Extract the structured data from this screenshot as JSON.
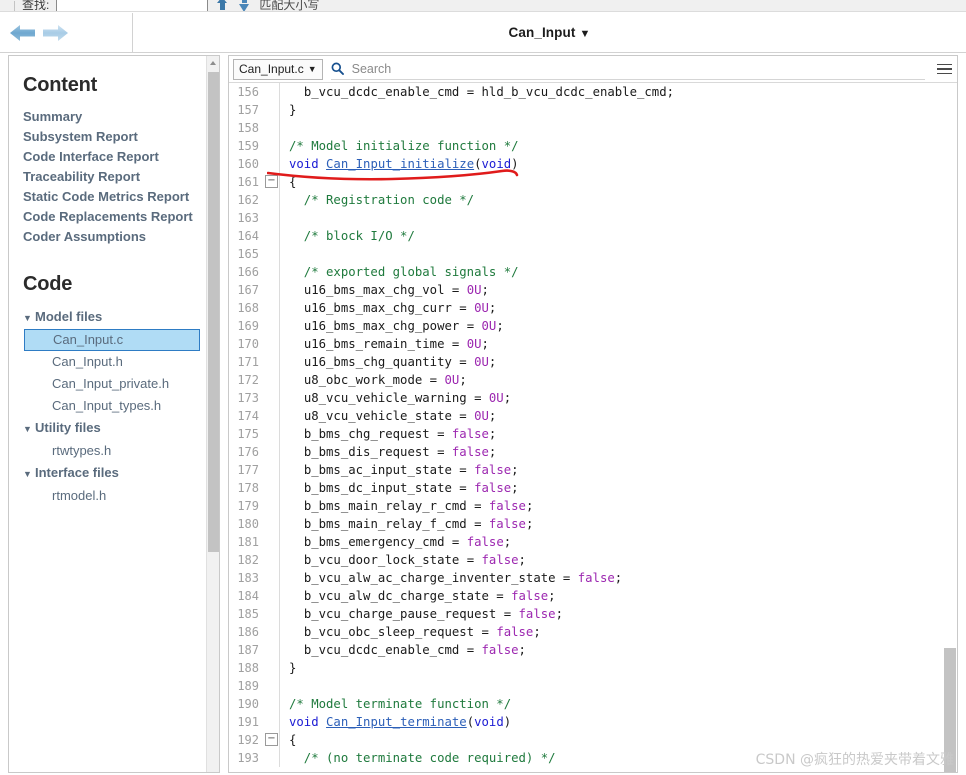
{
  "find_toolbar": {
    "label": "查找:",
    "input_value": "",
    "up_icon": "arrow-up-icon",
    "down_icon": "arrow-down-icon",
    "match_case_label": "匹配大小写"
  },
  "navbar": {
    "back_icon": "back-arrow-icon",
    "forward_icon": "forward-arrow-icon",
    "title": "Can_Input",
    "title_caret": "▼"
  },
  "sidebar": {
    "content_heading": "Content",
    "links": [
      {
        "label": "Summary"
      },
      {
        "label": "Subsystem Report"
      },
      {
        "label": "Code Interface Report"
      },
      {
        "label": "Traceability Report"
      },
      {
        "label": "Static Code Metrics Report"
      },
      {
        "label": "Code Replacements Report"
      },
      {
        "label": "Coder Assumptions"
      }
    ],
    "code_heading": "Code",
    "tree": [
      {
        "group": "Model files",
        "caret": "▼",
        "files": [
          {
            "name": "Can_Input.c",
            "selected": true
          },
          {
            "name": "Can_Input.h",
            "selected": false
          },
          {
            "name": "Can_Input_private.h",
            "selected": false
          },
          {
            "name": "Can_Input_types.h",
            "selected": false
          }
        ]
      },
      {
        "group": "Utility files",
        "caret": "▼",
        "files": [
          {
            "name": "rtwtypes.h",
            "selected": false
          }
        ]
      },
      {
        "group": "Interface files",
        "caret": "▼",
        "files": [
          {
            "name": "rtmodel.h",
            "selected": false
          }
        ]
      }
    ]
  },
  "code_panel": {
    "file_selector": "Can_Input.c",
    "file_selector_caret": "▼",
    "search_icon": "search-icon",
    "search_placeholder": "Search",
    "search_value": "",
    "menu_icon": "hamburger-menu-icon",
    "first_line_number": 156,
    "lines": [
      {
        "n": 156,
        "fold": false,
        "tokens": [
          {
            "t": "  ",
            "c": "tk-punct"
          },
          {
            "t": "b_vcu_dcdc_enable_cmd",
            "c": "tk-id"
          },
          {
            "t": " = ",
            "c": "tk-punct"
          },
          {
            "t": "hld_b_vcu_dcdc_enable_cmd",
            "c": "tk-id"
          },
          {
            "t": ";",
            "c": "tk-punct"
          }
        ]
      },
      {
        "n": 157,
        "fold": false,
        "tokens": [
          {
            "t": "}",
            "c": "tk-punct"
          }
        ]
      },
      {
        "n": 158,
        "fold": false,
        "tokens": []
      },
      {
        "n": 159,
        "fold": false,
        "tokens": [
          {
            "t": "/* Model initialize function */",
            "c": "tk-comment"
          }
        ]
      },
      {
        "n": 160,
        "fold": false,
        "tokens": [
          {
            "t": "void",
            "c": "tk-kw"
          },
          {
            "t": " ",
            "c": "tk-punct"
          },
          {
            "t": "Can_Input_initialize",
            "c": "tk-fn"
          },
          {
            "t": "(",
            "c": "tk-punct"
          },
          {
            "t": "void",
            "c": "tk-kw"
          },
          {
            "t": ")",
            "c": "tk-punct"
          }
        ]
      },
      {
        "n": 161,
        "fold": true,
        "tokens": [
          {
            "t": "{",
            "c": "tk-punct"
          }
        ]
      },
      {
        "n": 162,
        "fold": false,
        "tokens": [
          {
            "t": "  /* Registration code */",
            "c": "tk-comment"
          }
        ]
      },
      {
        "n": 163,
        "fold": false,
        "tokens": []
      },
      {
        "n": 164,
        "fold": false,
        "tokens": [
          {
            "t": "  /* block I/O */",
            "c": "tk-comment"
          }
        ]
      },
      {
        "n": 165,
        "fold": false,
        "tokens": []
      },
      {
        "n": 166,
        "fold": false,
        "tokens": [
          {
            "t": "  /* exported global signals */",
            "c": "tk-comment"
          }
        ]
      },
      {
        "n": 167,
        "fold": false,
        "tokens": [
          {
            "t": "  ",
            "c": "tk-punct"
          },
          {
            "t": "u16_bms_max_chg_vol",
            "c": "tk-id"
          },
          {
            "t": " = ",
            "c": "tk-punct"
          },
          {
            "t": "0U",
            "c": "tk-num"
          },
          {
            "t": ";",
            "c": "tk-punct"
          }
        ]
      },
      {
        "n": 168,
        "fold": false,
        "tokens": [
          {
            "t": "  ",
            "c": "tk-punct"
          },
          {
            "t": "u16_bms_max_chg_curr",
            "c": "tk-id"
          },
          {
            "t": " = ",
            "c": "tk-punct"
          },
          {
            "t": "0U",
            "c": "tk-num"
          },
          {
            "t": ";",
            "c": "tk-punct"
          }
        ]
      },
      {
        "n": 169,
        "fold": false,
        "tokens": [
          {
            "t": "  ",
            "c": "tk-punct"
          },
          {
            "t": "u16_bms_max_chg_power",
            "c": "tk-id"
          },
          {
            "t": " = ",
            "c": "tk-punct"
          },
          {
            "t": "0U",
            "c": "tk-num"
          },
          {
            "t": ";",
            "c": "tk-punct"
          }
        ]
      },
      {
        "n": 170,
        "fold": false,
        "tokens": [
          {
            "t": "  ",
            "c": "tk-punct"
          },
          {
            "t": "u16_bms_remain_time",
            "c": "tk-id"
          },
          {
            "t": " = ",
            "c": "tk-punct"
          },
          {
            "t": "0U",
            "c": "tk-num"
          },
          {
            "t": ";",
            "c": "tk-punct"
          }
        ]
      },
      {
        "n": 171,
        "fold": false,
        "tokens": [
          {
            "t": "  ",
            "c": "tk-punct"
          },
          {
            "t": "u16_bms_chg_quantity",
            "c": "tk-id"
          },
          {
            "t": " = ",
            "c": "tk-punct"
          },
          {
            "t": "0U",
            "c": "tk-num"
          },
          {
            "t": ";",
            "c": "tk-punct"
          }
        ]
      },
      {
        "n": 172,
        "fold": false,
        "tokens": [
          {
            "t": "  ",
            "c": "tk-punct"
          },
          {
            "t": "u8_obc_work_mode",
            "c": "tk-id"
          },
          {
            "t": " = ",
            "c": "tk-punct"
          },
          {
            "t": "0U",
            "c": "tk-num"
          },
          {
            "t": ";",
            "c": "tk-punct"
          }
        ]
      },
      {
        "n": 173,
        "fold": false,
        "tokens": [
          {
            "t": "  ",
            "c": "tk-punct"
          },
          {
            "t": "u8_vcu_vehicle_warning",
            "c": "tk-id"
          },
          {
            "t": " = ",
            "c": "tk-punct"
          },
          {
            "t": "0U",
            "c": "tk-num"
          },
          {
            "t": ";",
            "c": "tk-punct"
          }
        ]
      },
      {
        "n": 174,
        "fold": false,
        "tokens": [
          {
            "t": "  ",
            "c": "tk-punct"
          },
          {
            "t": "u8_vcu_vehicle_state",
            "c": "tk-id"
          },
          {
            "t": " = ",
            "c": "tk-punct"
          },
          {
            "t": "0U",
            "c": "tk-num"
          },
          {
            "t": ";",
            "c": "tk-punct"
          }
        ]
      },
      {
        "n": 175,
        "fold": false,
        "tokens": [
          {
            "t": "  ",
            "c": "tk-punct"
          },
          {
            "t": "b_bms_chg_request",
            "c": "tk-id"
          },
          {
            "t": " = ",
            "c": "tk-punct"
          },
          {
            "t": "false",
            "c": "tk-bool"
          },
          {
            "t": ";",
            "c": "tk-punct"
          }
        ]
      },
      {
        "n": 176,
        "fold": false,
        "tokens": [
          {
            "t": "  ",
            "c": "tk-punct"
          },
          {
            "t": "b_bms_dis_request",
            "c": "tk-id"
          },
          {
            "t": " = ",
            "c": "tk-punct"
          },
          {
            "t": "false",
            "c": "tk-bool"
          },
          {
            "t": ";",
            "c": "tk-punct"
          }
        ]
      },
      {
        "n": 177,
        "fold": false,
        "tokens": [
          {
            "t": "  ",
            "c": "tk-punct"
          },
          {
            "t": "b_bms_ac_input_state",
            "c": "tk-id"
          },
          {
            "t": " = ",
            "c": "tk-punct"
          },
          {
            "t": "false",
            "c": "tk-bool"
          },
          {
            "t": ";",
            "c": "tk-punct"
          }
        ]
      },
      {
        "n": 178,
        "fold": false,
        "tokens": [
          {
            "t": "  ",
            "c": "tk-punct"
          },
          {
            "t": "b_bms_dc_input_state",
            "c": "tk-id"
          },
          {
            "t": " = ",
            "c": "tk-punct"
          },
          {
            "t": "false",
            "c": "tk-bool"
          },
          {
            "t": ";",
            "c": "tk-punct"
          }
        ]
      },
      {
        "n": 179,
        "fold": false,
        "tokens": [
          {
            "t": "  ",
            "c": "tk-punct"
          },
          {
            "t": "b_bms_main_relay_r_cmd",
            "c": "tk-id"
          },
          {
            "t": " = ",
            "c": "tk-punct"
          },
          {
            "t": "false",
            "c": "tk-bool"
          },
          {
            "t": ";",
            "c": "tk-punct"
          }
        ]
      },
      {
        "n": 180,
        "fold": false,
        "tokens": [
          {
            "t": "  ",
            "c": "tk-punct"
          },
          {
            "t": "b_bms_main_relay_f_cmd",
            "c": "tk-id"
          },
          {
            "t": " = ",
            "c": "tk-punct"
          },
          {
            "t": "false",
            "c": "tk-bool"
          },
          {
            "t": ";",
            "c": "tk-punct"
          }
        ]
      },
      {
        "n": 181,
        "fold": false,
        "tokens": [
          {
            "t": "  ",
            "c": "tk-punct"
          },
          {
            "t": "b_bms_emergency_cmd",
            "c": "tk-id"
          },
          {
            "t": " = ",
            "c": "tk-punct"
          },
          {
            "t": "false",
            "c": "tk-bool"
          },
          {
            "t": ";",
            "c": "tk-punct"
          }
        ]
      },
      {
        "n": 182,
        "fold": false,
        "tokens": [
          {
            "t": "  ",
            "c": "tk-punct"
          },
          {
            "t": "b_vcu_door_lock_state",
            "c": "tk-id"
          },
          {
            "t": " = ",
            "c": "tk-punct"
          },
          {
            "t": "false",
            "c": "tk-bool"
          },
          {
            "t": ";",
            "c": "tk-punct"
          }
        ]
      },
      {
        "n": 183,
        "fold": false,
        "tokens": [
          {
            "t": "  ",
            "c": "tk-punct"
          },
          {
            "t": "b_vcu_alw_ac_charge_inventer_state",
            "c": "tk-id"
          },
          {
            "t": " = ",
            "c": "tk-punct"
          },
          {
            "t": "false",
            "c": "tk-bool"
          },
          {
            "t": ";",
            "c": "tk-punct"
          }
        ]
      },
      {
        "n": 184,
        "fold": false,
        "tokens": [
          {
            "t": "  ",
            "c": "tk-punct"
          },
          {
            "t": "b_vcu_alw_dc_charge_state",
            "c": "tk-id"
          },
          {
            "t": " = ",
            "c": "tk-punct"
          },
          {
            "t": "false",
            "c": "tk-bool"
          },
          {
            "t": ";",
            "c": "tk-punct"
          }
        ]
      },
      {
        "n": 185,
        "fold": false,
        "tokens": [
          {
            "t": "  ",
            "c": "tk-punct"
          },
          {
            "t": "b_vcu_charge_pause_request",
            "c": "tk-id"
          },
          {
            "t": " = ",
            "c": "tk-punct"
          },
          {
            "t": "false",
            "c": "tk-bool"
          },
          {
            "t": ";",
            "c": "tk-punct"
          }
        ]
      },
      {
        "n": 186,
        "fold": false,
        "tokens": [
          {
            "t": "  ",
            "c": "tk-punct"
          },
          {
            "t": "b_vcu_obc_sleep_request",
            "c": "tk-id"
          },
          {
            "t": " = ",
            "c": "tk-punct"
          },
          {
            "t": "false",
            "c": "tk-bool"
          },
          {
            "t": ";",
            "c": "tk-punct"
          }
        ]
      },
      {
        "n": 187,
        "fold": false,
        "tokens": [
          {
            "t": "  ",
            "c": "tk-punct"
          },
          {
            "t": "b_vcu_dcdc_enable_cmd",
            "c": "tk-id"
          },
          {
            "t": " = ",
            "c": "tk-punct"
          },
          {
            "t": "false",
            "c": "tk-bool"
          },
          {
            "t": ";",
            "c": "tk-punct"
          }
        ]
      },
      {
        "n": 188,
        "fold": false,
        "tokens": [
          {
            "t": "}",
            "c": "tk-punct"
          }
        ]
      },
      {
        "n": 189,
        "fold": false,
        "tokens": []
      },
      {
        "n": 190,
        "fold": false,
        "tokens": [
          {
            "t": "/* Model terminate function */",
            "c": "tk-comment"
          }
        ]
      },
      {
        "n": 191,
        "fold": false,
        "tokens": [
          {
            "t": "void",
            "c": "tk-kw"
          },
          {
            "t": " ",
            "c": "tk-punct"
          },
          {
            "t": "Can_Input_terminate",
            "c": "tk-fn"
          },
          {
            "t": "(",
            "c": "tk-punct"
          },
          {
            "t": "void",
            "c": "tk-kw"
          },
          {
            "t": ")",
            "c": "tk-punct"
          }
        ]
      },
      {
        "n": 192,
        "fold": true,
        "tokens": [
          {
            "t": "{",
            "c": "tk-punct"
          }
        ]
      },
      {
        "n": 193,
        "fold": false,
        "tokens": [
          {
            "t": "  /* (no terminate code required) */",
            "c": "tk-comment"
          }
        ]
      }
    ],
    "annotation": {
      "type": "red-underline",
      "target_line": 160,
      "target_text": "void Can_Input_initialize(void)",
      "color": "#e01b1b"
    }
  },
  "watermark": "CSDN @疯狂的热爱夹带着文雅",
  "colors": {
    "selection_bg": "#b0dcf5",
    "selection_border": "#2e7cc4",
    "link": "#5a6b7d",
    "comment": "#1f7a3d",
    "keyword": "#1c1cd4",
    "function": "#2c5fb8",
    "literal": "#9c27b0",
    "annotation_red": "#e01b1b"
  }
}
